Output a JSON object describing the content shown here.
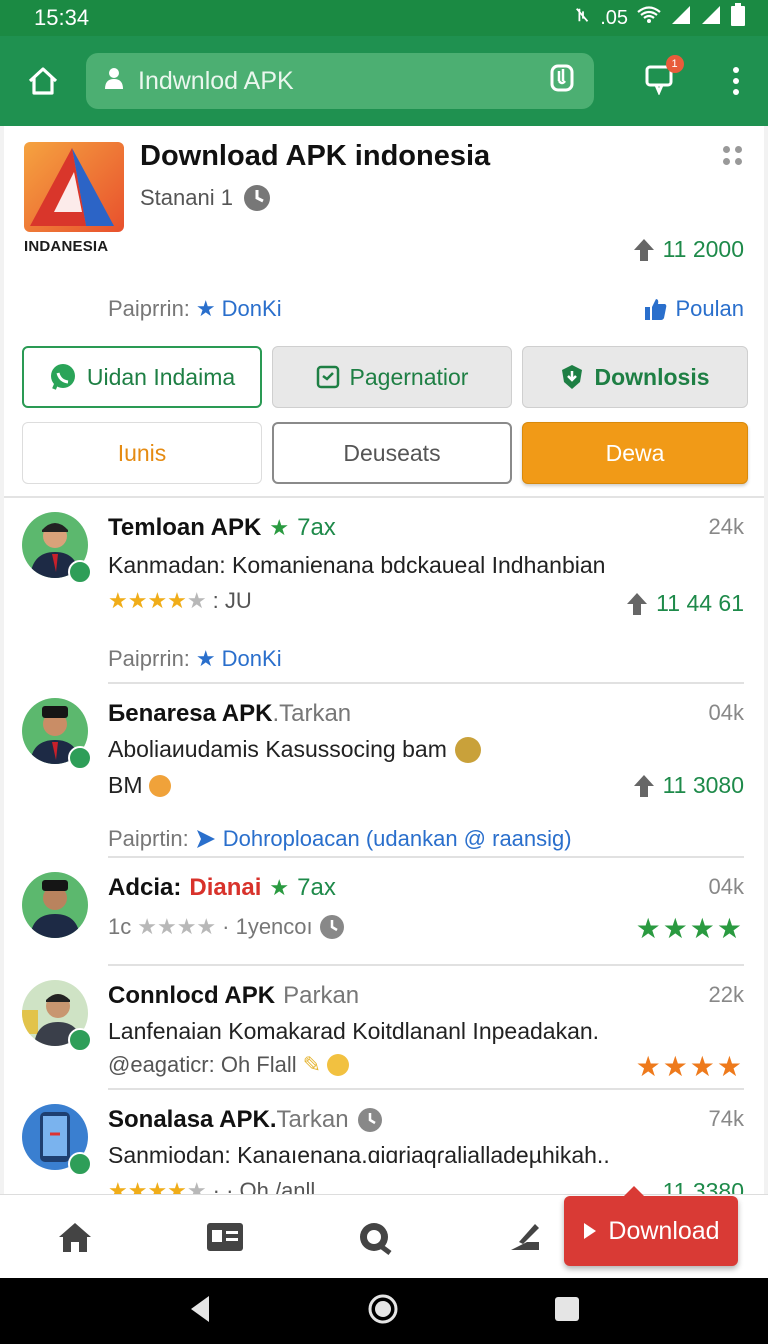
{
  "status_bar": {
    "time": "15:34",
    "network": ".05"
  },
  "toolbar": {
    "url": "Indwnlod APK",
    "notification_count": "1"
  },
  "app": {
    "title": "Download APK indonesia",
    "subtitle": "Stanani 1",
    "logo_caption": "INDANESIA",
    "count": "11 2000",
    "publisher_label": "Paiprrin:",
    "publisher_name": "DonKi",
    "popular_label": "Poulan"
  },
  "buttons": {
    "row1": [
      "Uidan Indaima",
      "Pagernatior",
      "Downlosis"
    ],
    "row2": [
      "Iunis",
      "Deuseats",
      "Dewa"
    ]
  },
  "list": [
    {
      "title": "Temloan APK",
      "tag": "7ax",
      "size": "24k",
      "desc": "Kanmadan: Komanienana bdckaueal Indhanbian",
      "rating_text": ": JU",
      "count": "11 44 61",
      "publisher_label": "Paiprrin:",
      "publisher": "DonKi"
    },
    {
      "title": "Бenaresa APK",
      "tag": ".Tarkan",
      "size": "04k",
      "desc": "Aboliaиudamis Kasussocing bam",
      "desc2": "BM",
      "count": "11 3080",
      "publisher_label": "Paiprtin:",
      "publisher": "Dohroploacan (udankan @ raansig)"
    },
    {
      "title": "Adcia:",
      "brand": "Dianai",
      "tag": "7ax",
      "size": "04k",
      "meta_prefix": "1c",
      "meta_text": "· 1yencoı"
    },
    {
      "title": "Connlocd APK",
      "tag": "Parkan",
      "size": "22k",
      "desc": "Lanfenaian Komakarad Koitdlananl Inpeadakan.",
      "meta_text": "@eagaticr: Oh Flall"
    },
    {
      "title": "Sonalasa APK.",
      "tag": "Tarkan",
      "size": "74k",
      "desc": "Sanmiodan: Kanaıenana.ɑiɑriaqɾalialladeµhikah..",
      "meta_text": "· · Oh /anll",
      "count": "11 3380"
    }
  ],
  "download_fab": {
    "label": "Download"
  },
  "colors": {
    "brand_green": "#1f9150",
    "accent_orange": "#f19a17",
    "fab_red": "#d93a35"
  }
}
